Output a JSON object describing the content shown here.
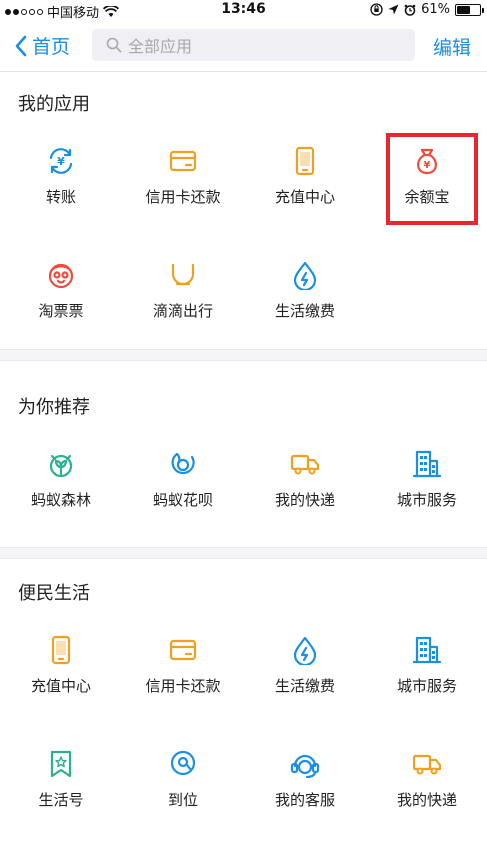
{
  "status": {
    "carrier": "中国移动",
    "time": "13:46",
    "battery": "61%",
    "battery_level": 0.61
  },
  "nav": {
    "back_label": "首页",
    "search_placeholder": "全部应用",
    "edit_label": "编辑"
  },
  "sections": {
    "my_apps": {
      "title": "我的应用",
      "items": [
        {
          "label": "转账",
          "icon": "transfer-icon",
          "color": "#1a8fe3"
        },
        {
          "label": "信用卡还款",
          "icon": "credit-card-icon",
          "color": "#f0a020"
        },
        {
          "label": "充值中心",
          "icon": "phone-topup-icon",
          "color": "#f0a020"
        },
        {
          "label": "余额宝",
          "icon": "money-bag-icon",
          "color": "#f04a3a"
        },
        {
          "label": "淘票票",
          "icon": "taopiaopiao-icon",
          "color": "#f04a3a"
        },
        {
          "label": "滴滴出行",
          "icon": "didi-icon",
          "color": "#f0a020"
        },
        {
          "label": "生活缴费",
          "icon": "utility-drop-icon",
          "color": "#1a8fe3"
        }
      ]
    },
    "recommend": {
      "title": "为你推荐",
      "items": [
        {
          "label": "蚂蚁森林",
          "icon": "ant-forest-icon",
          "color": "#2bb090"
        },
        {
          "label": "蚂蚁花呗",
          "icon": "huabei-icon",
          "color": "#1a8fe3"
        },
        {
          "label": "我的快递",
          "icon": "delivery-truck-icon",
          "color": "#f0a020"
        },
        {
          "label": "城市服务",
          "icon": "city-building-icon",
          "color": "#1a8fe3"
        }
      ]
    },
    "life": {
      "title": "便民生活",
      "items": [
        {
          "label": "充值中心",
          "icon": "phone-topup-icon",
          "color": "#f0a020"
        },
        {
          "label": "信用卡还款",
          "icon": "credit-card-icon",
          "color": "#f0a020"
        },
        {
          "label": "生活缴费",
          "icon": "utility-drop-icon",
          "color": "#1a8fe3"
        },
        {
          "label": "城市服务",
          "icon": "city-building-icon",
          "color": "#1a8fe3"
        },
        {
          "label": "生活号",
          "icon": "bookmark-star-icon",
          "color": "#2bb090"
        },
        {
          "label": "到位",
          "icon": "location-pin-icon",
          "color": "#1a8fe3"
        },
        {
          "label": "我的客服",
          "icon": "customer-service-icon",
          "color": "#1a8fe3"
        },
        {
          "label": "我的快递",
          "icon": "delivery-truck-icon",
          "color": "#f0a020"
        }
      ]
    }
  },
  "highlight_color": "#e8262d"
}
